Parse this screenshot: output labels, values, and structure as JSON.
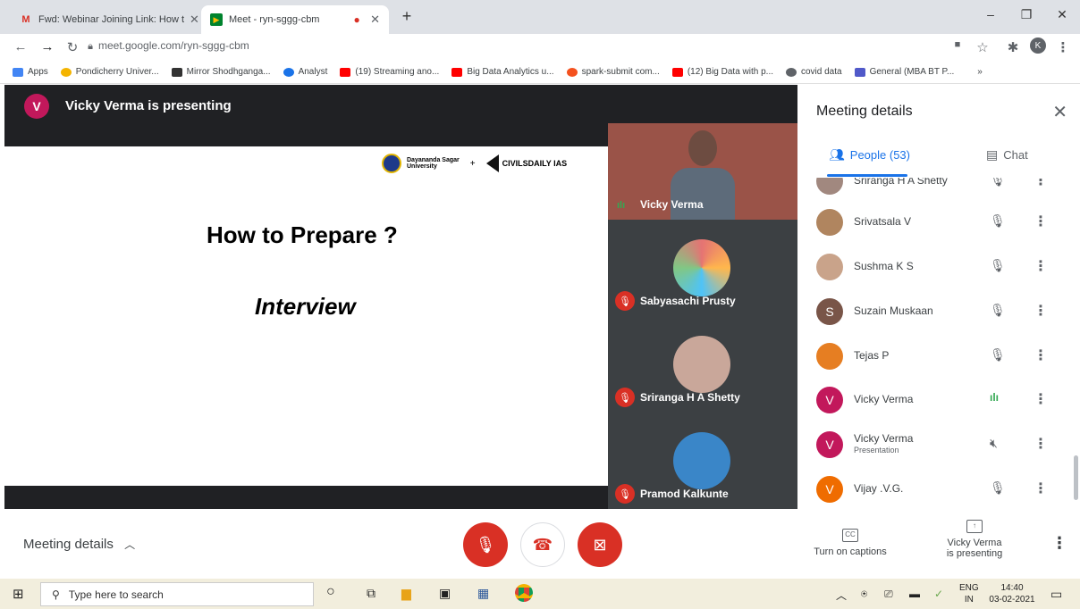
{
  "tabs": [
    {
      "title": "Fwd: Webinar Joining Link: How t",
      "icon": "gmail-icon",
      "color": "#d93025"
    },
    {
      "title": "Meet - ryn-sggg-cbm",
      "icon": "meet-icon",
      "color": "#00832d"
    }
  ],
  "address": {
    "url": "meet.google.com/ryn-sggg-cbm",
    "profile_letter": "K"
  },
  "bookmarks": [
    {
      "label": "Apps",
      "color": "#4285f4"
    },
    {
      "label": "Pondicherry Univer...",
      "color": "#f4b400"
    },
    {
      "label": "Mirror Shodhganga...",
      "color": "#333333"
    },
    {
      "label": "Analyst",
      "color": "#1a73e8"
    },
    {
      "label": "(19) Streaming ano...",
      "color": "#ff0000"
    },
    {
      "label": "Big Data Analytics u...",
      "color": "#ff0000"
    },
    {
      "label": "spark-submit com...",
      "color": "#f4511e"
    },
    {
      "label": "(12) Big Data with p...",
      "color": "#ff0000"
    },
    {
      "label": "covid data",
      "color": "#5f6368"
    },
    {
      "label": "General (MBA BT P...",
      "color": "#5059c9"
    }
  ],
  "presenter": {
    "avatar_letter": "V",
    "text": "Vicky Verma is presenting",
    "avatar_color": "#c2185b"
  },
  "slide": {
    "title": "How to Prepare ?",
    "subtitle": "Interview",
    "logo_left": "Dayananda Sagar",
    "logo_left2": "University",
    "logo_plus": "+",
    "logo_right": "CIVILSDAILY IAS"
  },
  "tiles": [
    {
      "name": "Vicky Verma",
      "muted": false
    },
    {
      "name": "Sabyasachi Prusty",
      "muted": true
    },
    {
      "name": "Sriranga H A Shetty",
      "muted": true
    },
    {
      "name": "Pramod Kalkunte",
      "muted": true
    }
  ],
  "panel": {
    "title": "Meeting details",
    "people_tab": "People (53)",
    "chat_tab": "Chat",
    "people": [
      {
        "name": "Sriranga H A Shetty",
        "sub": "",
        "avatar": "",
        "color": "#a1887f",
        "mic": "muted"
      },
      {
        "name": "Srivatsala V",
        "sub": "",
        "avatar": "",
        "color": "#b0855f",
        "mic": "muted"
      },
      {
        "name": "Sushma K S",
        "sub": "",
        "avatar": "",
        "color": "#c9a38a",
        "mic": "muted"
      },
      {
        "name": "Suzain Muskaan",
        "sub": "",
        "avatar": "S",
        "color": "#795548",
        "mic": "muted"
      },
      {
        "name": "Tejas P",
        "sub": "",
        "avatar": "",
        "color": "#e67e22",
        "mic": "muted"
      },
      {
        "name": "Vicky Verma",
        "sub": "",
        "avatar": "V",
        "color": "#c2185b",
        "mic": "speaking"
      },
      {
        "name": "Vicky Verma",
        "sub": "Presentation",
        "avatar": "V",
        "color": "#c2185b",
        "mic": "presenting"
      },
      {
        "name": "Vijay .V.G.",
        "sub": "",
        "avatar": "V",
        "color": "#ef6c00",
        "mic": "muted"
      }
    ]
  },
  "bottom": {
    "meeting_details": "Meeting details",
    "captions": "Turn on captions",
    "presenting_line1": "Vicky Verma",
    "presenting_line2": "is presenting",
    "cc": "CC"
  },
  "taskbar": {
    "search_placeholder": "Type here to search",
    "lang1": "ENG",
    "lang2": "IN",
    "time": "14:40",
    "date": "03-02-2021"
  }
}
